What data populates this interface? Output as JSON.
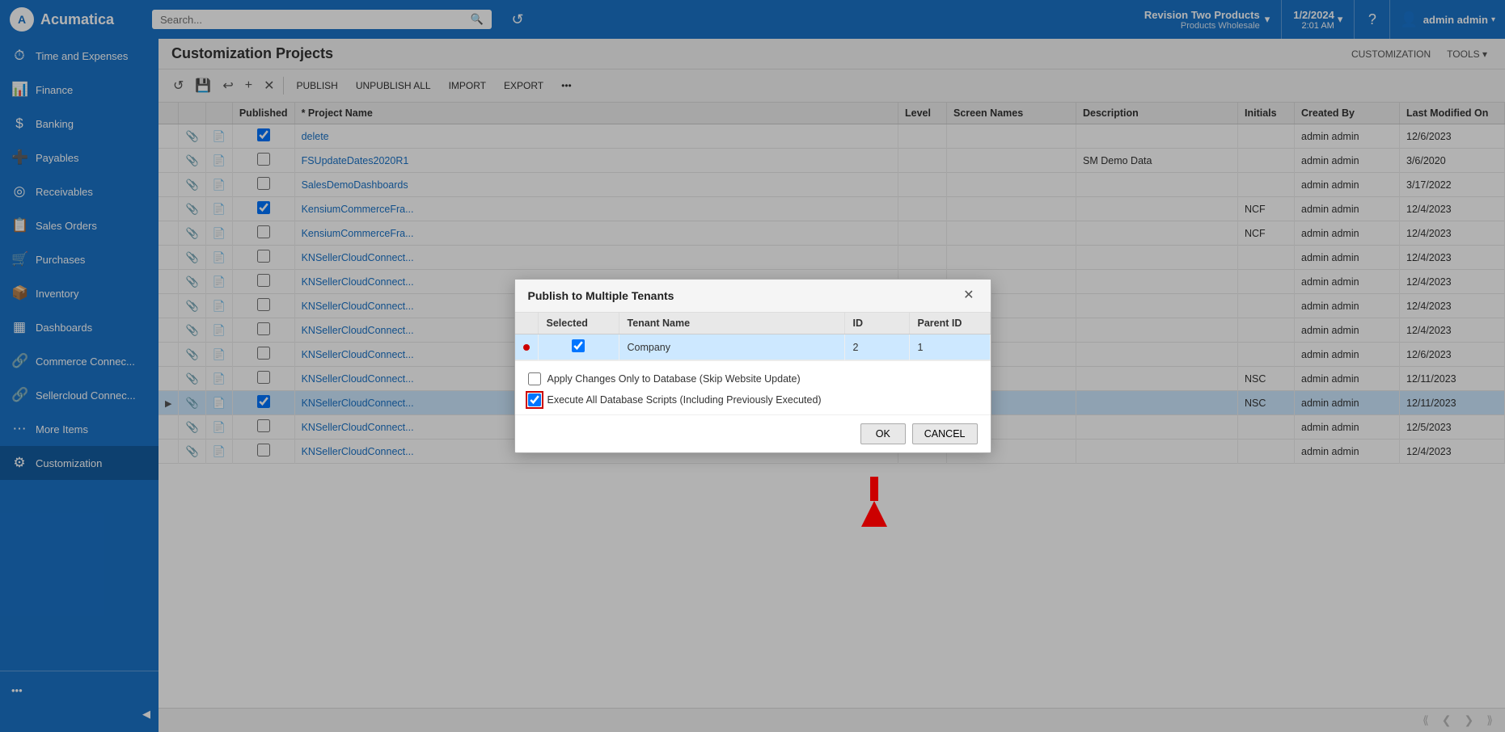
{
  "navbar": {
    "logo_text": "Acumatica",
    "search_placeholder": "Search...",
    "tenant_name": "Revision Two Products",
    "tenant_sub": "Products Wholesale",
    "date": "1/2/2024",
    "time": "2:01 AM",
    "username": "admin admin",
    "chevron": "▾"
  },
  "sidebar": {
    "items": [
      {
        "label": "Time and Expenses",
        "icon": "⏱"
      },
      {
        "label": "Finance",
        "icon": "📊"
      },
      {
        "label": "Banking",
        "icon": "$"
      },
      {
        "label": "Payables",
        "icon": "➕"
      },
      {
        "label": "Receivables",
        "icon": "◎"
      },
      {
        "label": "Sales Orders",
        "icon": "📋"
      },
      {
        "label": "Purchases",
        "icon": "🛒"
      },
      {
        "label": "Inventory",
        "icon": "📦"
      },
      {
        "label": "Dashboards",
        "icon": "▦"
      },
      {
        "label": "Commerce Connec...",
        "icon": "🔗"
      },
      {
        "label": "Sellercloud Connec...",
        "icon": "🔗"
      },
      {
        "label": "More Items",
        "icon": "⋯"
      },
      {
        "label": "Customization",
        "icon": "⚙",
        "active": true
      }
    ],
    "bottom_label": "...",
    "collapse_icon": "◀"
  },
  "page": {
    "title": "Customization Projects",
    "header_actions": [
      "CUSTOMIZATION",
      "TOOLS ▾"
    ]
  },
  "toolbar": {
    "buttons": [
      "PUBLISH",
      "UNPUBLISH ALL",
      "IMPORT",
      "EXPORT",
      "•••"
    ],
    "icons": [
      "↺",
      "💾",
      "↩",
      "+",
      "✕"
    ]
  },
  "table": {
    "columns": [
      "",
      "",
      "",
      "Published",
      "* Project Name",
      "Level",
      "Screen Names",
      "Description",
      "Initials",
      "Created By",
      "Last Modified On"
    ],
    "rows": [
      {
        "published_cb": true,
        "selected_cb": true,
        "project_name": "delete",
        "level": "",
        "screen_names": "",
        "description": "",
        "initials": "",
        "created_by": "admin admin",
        "last_modified": "12/6/2023",
        "expand": false,
        "row_selected": false
      },
      {
        "published_cb": false,
        "selected_cb": false,
        "project_name": "FSUpdateDates2020R1",
        "level": "",
        "screen_names": "",
        "description": "SM Demo Data",
        "initials": "",
        "created_by": "admin admin",
        "last_modified": "3/6/2020",
        "expand": false,
        "row_selected": false
      },
      {
        "published_cb": false,
        "selected_cb": false,
        "project_name": "SalesDemoDashboards",
        "level": "",
        "screen_names": "",
        "description": "",
        "initials": "",
        "created_by": "admin admin",
        "last_modified": "3/17/2022",
        "expand": false,
        "row_selected": false
      },
      {
        "published_cb": true,
        "selected_cb": true,
        "project_name": "KensiumCommerceFra...",
        "level": "",
        "screen_names": "",
        "description": "",
        "initials": "NCF",
        "created_by": "admin admin",
        "last_modified": "12/4/2023",
        "expand": false,
        "row_selected": false
      },
      {
        "published_cb": false,
        "selected_cb": false,
        "project_name": "KensiumCommerceFra...",
        "level": "",
        "screen_names": "",
        "description": "",
        "initials": "NCF",
        "created_by": "admin admin",
        "last_modified": "12/4/2023",
        "expand": false,
        "row_selected": false
      },
      {
        "published_cb": false,
        "selected_cb": false,
        "project_name": "KNSellerCloudConnect...",
        "level": "",
        "screen_names": "",
        "description": "",
        "initials": "",
        "created_by": "admin admin",
        "last_modified": "12/4/2023",
        "expand": false,
        "row_selected": false
      },
      {
        "published_cb": false,
        "selected_cb": false,
        "project_name": "KNSellerCloudConnect...",
        "level": "",
        "screen_names": "",
        "description": "",
        "initials": "",
        "created_by": "admin admin",
        "last_modified": "12/4/2023",
        "expand": false,
        "row_selected": false
      },
      {
        "published_cb": false,
        "selected_cb": false,
        "project_name": "KNSellerCloudConnect...",
        "level": "",
        "screen_names": "",
        "description": "",
        "initials": "",
        "created_by": "admin admin",
        "last_modified": "12/4/2023",
        "expand": false,
        "row_selected": false
      },
      {
        "published_cb": false,
        "selected_cb": false,
        "project_name": "KNSellerCloudConnect...",
        "level": "",
        "screen_names": "",
        "description": "",
        "initials": "",
        "created_by": "admin admin",
        "last_modified": "12/4/2023",
        "expand": false,
        "row_selected": false
      },
      {
        "published_cb": false,
        "selected_cb": false,
        "project_name": "KNSellerCloudConnect...",
        "level": "",
        "screen_names": "",
        "description": "",
        "initials": "",
        "created_by": "admin admin",
        "last_modified": "12/6/2023",
        "expand": false,
        "row_selected": false
      },
      {
        "published_cb": false,
        "selected_cb": false,
        "project_name": "KNSellerCloudConnect...",
        "level": "",
        "screen_names": "",
        "description": "",
        "initials": "NSC",
        "created_by": "admin admin",
        "last_modified": "12/11/2023",
        "expand": false,
        "row_selected": false
      },
      {
        "published_cb": true,
        "selected_cb": true,
        "project_name": "KNSellerCloudConnect...",
        "level": "",
        "screen_names": "",
        "description": "",
        "initials": "NSC",
        "created_by": "admin admin",
        "last_modified": "12/11/2023",
        "expand": true,
        "row_selected": true
      },
      {
        "published_cb": false,
        "selected_cb": false,
        "project_name": "KNSellerCloudConnect...",
        "level": "",
        "screen_names": "",
        "description": "",
        "initials": "",
        "created_by": "admin admin",
        "last_modified": "12/5/2023",
        "expand": false,
        "row_selected": false
      },
      {
        "published_cb": false,
        "selected_cb": false,
        "project_name": "KNSellerCloudConnect...",
        "level": "",
        "screen_names": "",
        "description": "",
        "initials": "",
        "created_by": "admin admin",
        "last_modified": "12/4/2023",
        "expand": false,
        "row_selected": false
      }
    ]
  },
  "modal": {
    "title": "Publish to Multiple Tenants",
    "columns": {
      "selected": "Selected",
      "tenant_name": "Tenant Name",
      "id": "ID",
      "parent_id": "Parent ID"
    },
    "rows": [
      {
        "selected": true,
        "tenant_name": "Company",
        "id": "2",
        "parent_id": "1",
        "active": true
      }
    ],
    "option1_label": "Apply Changes Only to Database (Skip Website Update)",
    "option1_checked": false,
    "option2_label": "Execute All Database Scripts (Including Previously Executed)",
    "option2_checked": true,
    "btn_ok": "OK",
    "btn_cancel": "CANCEL"
  },
  "pagination": {
    "first": "⟪",
    "prev": "❮",
    "next": "❯",
    "last": "⟫"
  }
}
